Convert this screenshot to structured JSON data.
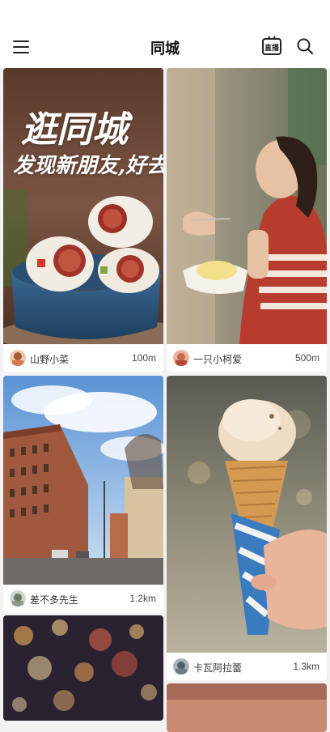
{
  "header": {
    "title": "同城",
    "live_label": "直播"
  },
  "feed": {
    "cards": [
      {
        "overlay_line1": "逛同城",
        "overlay_line2": "发现新朋友,好去处",
        "user": "山野小菜",
        "distance": "100m"
      },
      {
        "user": "一只小柯爱",
        "distance": "500m"
      },
      {
        "user": "差不多先生",
        "distance": "1.2km"
      },
      {
        "user": "卡瓦阿拉蕾",
        "distance": "1.3km"
      }
    ]
  }
}
